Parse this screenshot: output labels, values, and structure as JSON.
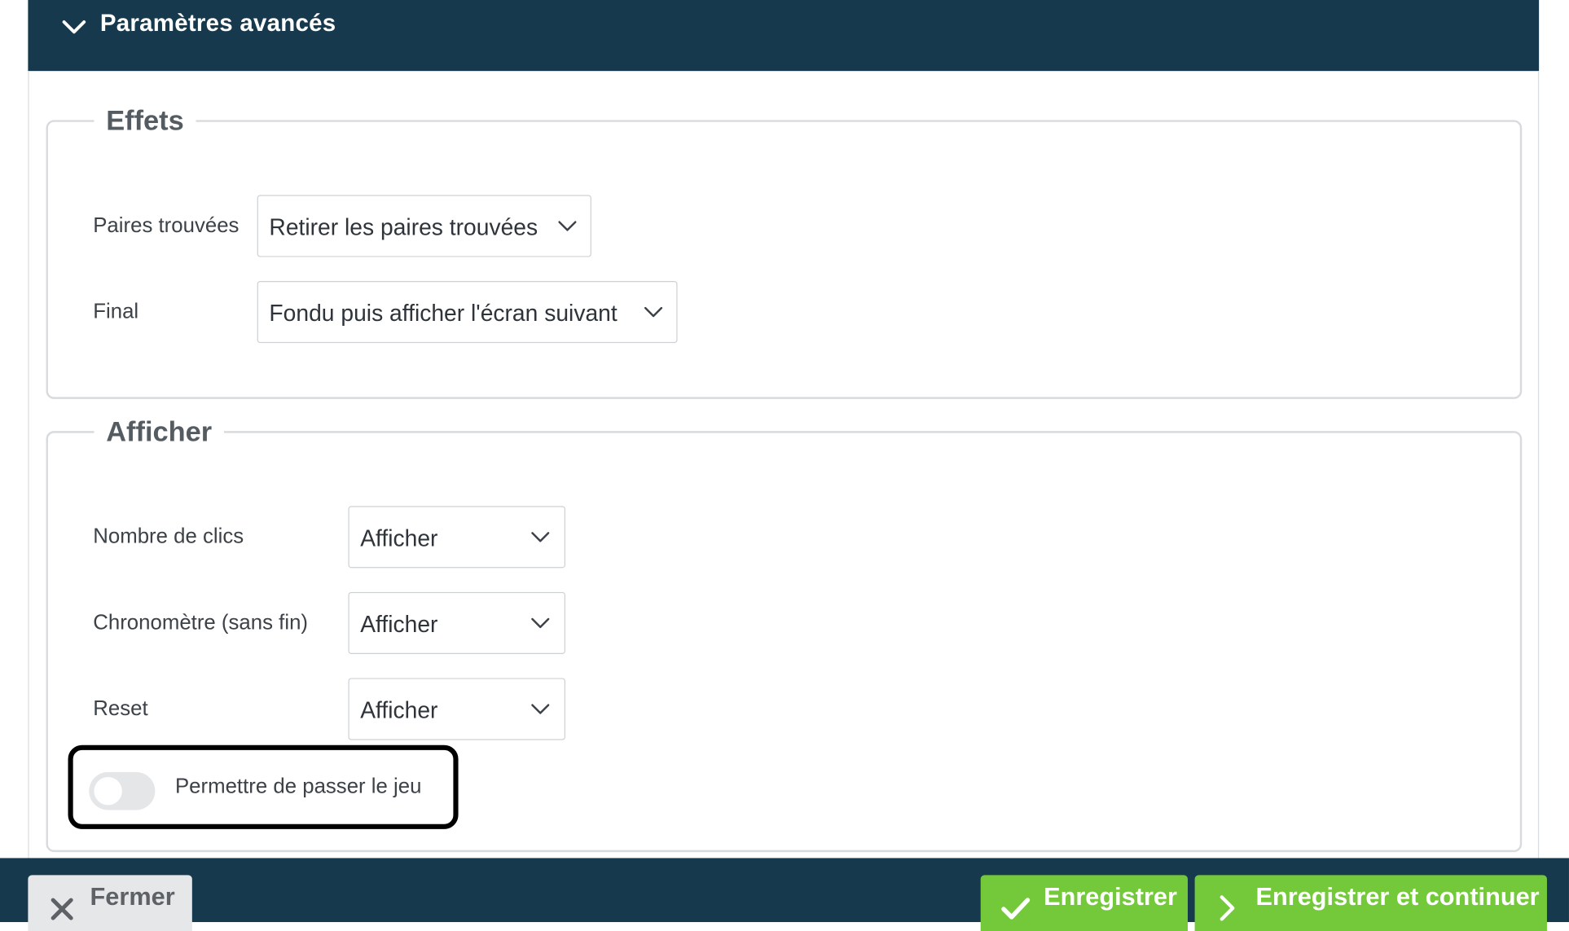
{
  "header": {
    "title": "Paramètres avancés",
    "icon": "chevron-down-icon"
  },
  "effets": {
    "legend": "Effets",
    "fields": [
      {
        "label": "Paires trouvées",
        "value": "Retirer les paires trouvées"
      },
      {
        "label": "Final",
        "value": "Fondu puis afficher l'écran suivant"
      }
    ]
  },
  "afficher": {
    "legend": "Afficher",
    "fields": [
      {
        "label": "Nombre de clics",
        "value": "Afficher"
      },
      {
        "label": "Chronomètre (sans fin)",
        "value": "Afficher"
      },
      {
        "label": "Reset",
        "value": "Afficher"
      }
    ],
    "toggle": {
      "label": "Permettre de passer le jeu",
      "checked": false
    }
  },
  "footer": {
    "close_label": "Fermer",
    "save_label": "Enregistrer",
    "save_continue_label": "Enregistrer et continuer"
  },
  "colors": {
    "header_bg": "#17394d",
    "footer_bg": "#17394d",
    "primary_button": "#74c93b",
    "secondary_button": "#e6e7e8",
    "highlight_border": "#000000"
  }
}
